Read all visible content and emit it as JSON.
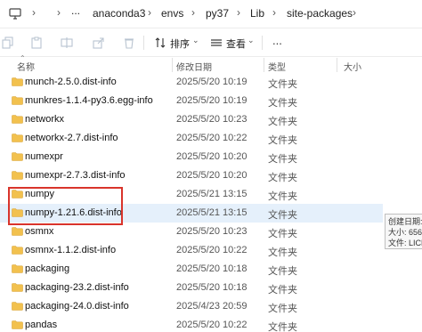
{
  "breadcrumb": {
    "more": "...",
    "items": [
      "anaconda3",
      "envs",
      "py37",
      "Lib",
      "site-packages"
    ]
  },
  "toolbar": {
    "sort_label": "排序",
    "view_label": "查看",
    "more": "..."
  },
  "columns": {
    "name": "名称",
    "modified": "修改日期",
    "type": "类型",
    "size": "大小"
  },
  "rows": [
    {
      "name": "munch-2.5.0.dist-info",
      "modified": "2025/5/20 10:19",
      "type": "文件夹"
    },
    {
      "name": "munkres-1.1.4-py3.6.egg-info",
      "modified": "2025/5/20 10:19",
      "type": "文件夹"
    },
    {
      "name": "networkx",
      "modified": "2025/5/20 10:23",
      "type": "文件夹"
    },
    {
      "name": "networkx-2.7.dist-info",
      "modified": "2025/5/20 10:22",
      "type": "文件夹"
    },
    {
      "name": "numexpr",
      "modified": "2025/5/20 10:20",
      "type": "文件夹"
    },
    {
      "name": "numexpr-2.7.3.dist-info",
      "modified": "2025/5/20 10:20",
      "type": "文件夹"
    },
    {
      "name": "numpy",
      "modified": "2025/5/21 13:15",
      "type": "文件夹"
    },
    {
      "name": "numpy-1.21.6.dist-info",
      "modified": "2025/5/21 13:15",
      "type": "文件夹"
    },
    {
      "name": "osmnx",
      "modified": "2025/5/20 10:23",
      "type": "文件夹"
    },
    {
      "name": "osmnx-1.1.2.dist-info",
      "modified": "2025/5/20 10:22",
      "type": "文件夹"
    },
    {
      "name": "packaging",
      "modified": "2025/5/20 10:18",
      "type": "文件夹"
    },
    {
      "name": "packaging-23.2.dist-info",
      "modified": "2025/5/20 10:18",
      "type": "文件夹"
    },
    {
      "name": "packaging-24.0.dist-info",
      "modified": "2025/4/23 20:59",
      "type": "文件夹"
    },
    {
      "name": "pandas",
      "modified": "2025/5/20 10:22",
      "type": "文件夹"
    }
  ],
  "tooltip": {
    "created": "创建日期:",
    "size": "大小: 656",
    "files": "文件: LICE"
  },
  "colors": {
    "folder": "#f2c14e",
    "selected_row": "#e5f0fb",
    "highlight": "#d9342b"
  }
}
